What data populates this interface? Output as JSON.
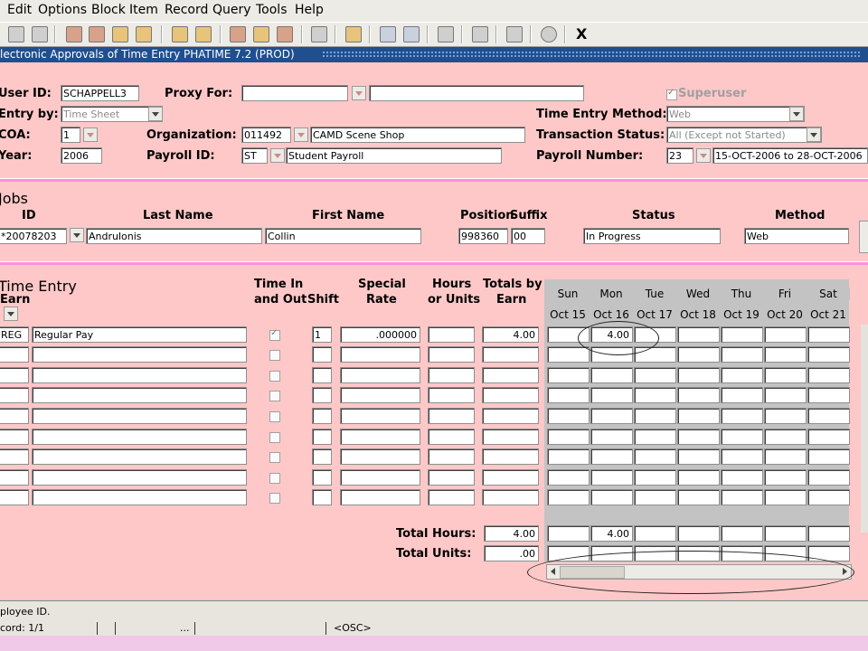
{
  "menu": [
    "Edit",
    "Options",
    "Block",
    "Item",
    "Record",
    "Query",
    "Tools",
    "Help"
  ],
  "close_glyph": "X",
  "title": {
    "text": "lectronic Approvals of Time Entry  PHATIME  7.2  (PROD)"
  },
  "key_block": {
    "user_id_label": "User ID:",
    "user_id": "SCHAPPELL3",
    "proxy_label": "Proxy For:",
    "proxy_value": "",
    "proxy_name": "",
    "superuser_label": "Superuser",
    "entry_by_label": "Entry by:",
    "entry_by": "Time Sheet",
    "time_entry_method_label": "Time Entry Method:",
    "time_entry_method": "Web",
    "coa_label": "COA:",
    "coa": "1",
    "org_label": "Organization:",
    "org_code": "011492",
    "org_name": "CAMD Scene Shop",
    "transaction_status_label": "Transaction Status:",
    "transaction_status": "All (Except not Started)",
    "year_label": "Year:",
    "year": "2006",
    "payroll_id_label": "Payroll ID:",
    "payroll_id": "ST",
    "payroll_name": "Student Payroll",
    "payroll_number_label": "Payroll Number:",
    "payroll_number": "23",
    "payroll_range": "15-OCT-2006 to 28-OCT-2006"
  },
  "jobs": {
    "heading": "Jobs",
    "col_id": "ID",
    "col_last": "Last Name",
    "col_first": "First Name",
    "col_position": "Position",
    "col_suffix": "Suffix",
    "col_status": "Status",
    "col_method": "Method",
    "row": {
      "id": "*20078203",
      "last": "Andrulonis",
      "first": "Collin",
      "position": "998360",
      "suffix": "00",
      "status": "In Progress",
      "method": "Web"
    }
  },
  "time_entry": {
    "heading": "Time Entry",
    "col_earn": "Earn",
    "col_time_in": "Time In",
    "col_time_out": "and Out",
    "col_shift": "Shift",
    "col_special": "Special",
    "col_rate": "Rate",
    "col_hours": "Hours",
    "col_units": "or Units",
    "col_totals": "Totals by",
    "col_totals2": "Earn",
    "days": [
      {
        "dow": "Sun",
        "date": "Oct 15"
      },
      {
        "dow": "Mon",
        "date": "Oct 16"
      },
      {
        "dow": "Tue",
        "date": "Oct 17"
      },
      {
        "dow": "Wed",
        "date": "Oct 18"
      },
      {
        "dow": "Thu",
        "date": "Oct 19"
      },
      {
        "dow": "Fri",
        "date": "Oct 20"
      },
      {
        "dow": "Sat",
        "date": "Oct 21"
      }
    ],
    "first_row": {
      "earn": "REG",
      "desc": "Regular Pay",
      "shift": "1",
      "special_rate": ".000000",
      "total": "4.00",
      "mon": "4.00"
    },
    "total_hours_label": "Total Hours:",
    "total_hours": "4.00",
    "total_units_label": "Total Units:",
    "total_units": ".00",
    "day_total_mon": "4.00"
  },
  "status": {
    "message": "ployee ID.",
    "record": "cord: 1/1",
    "ellipsis": "...",
    "mode": "<OSC>"
  }
}
